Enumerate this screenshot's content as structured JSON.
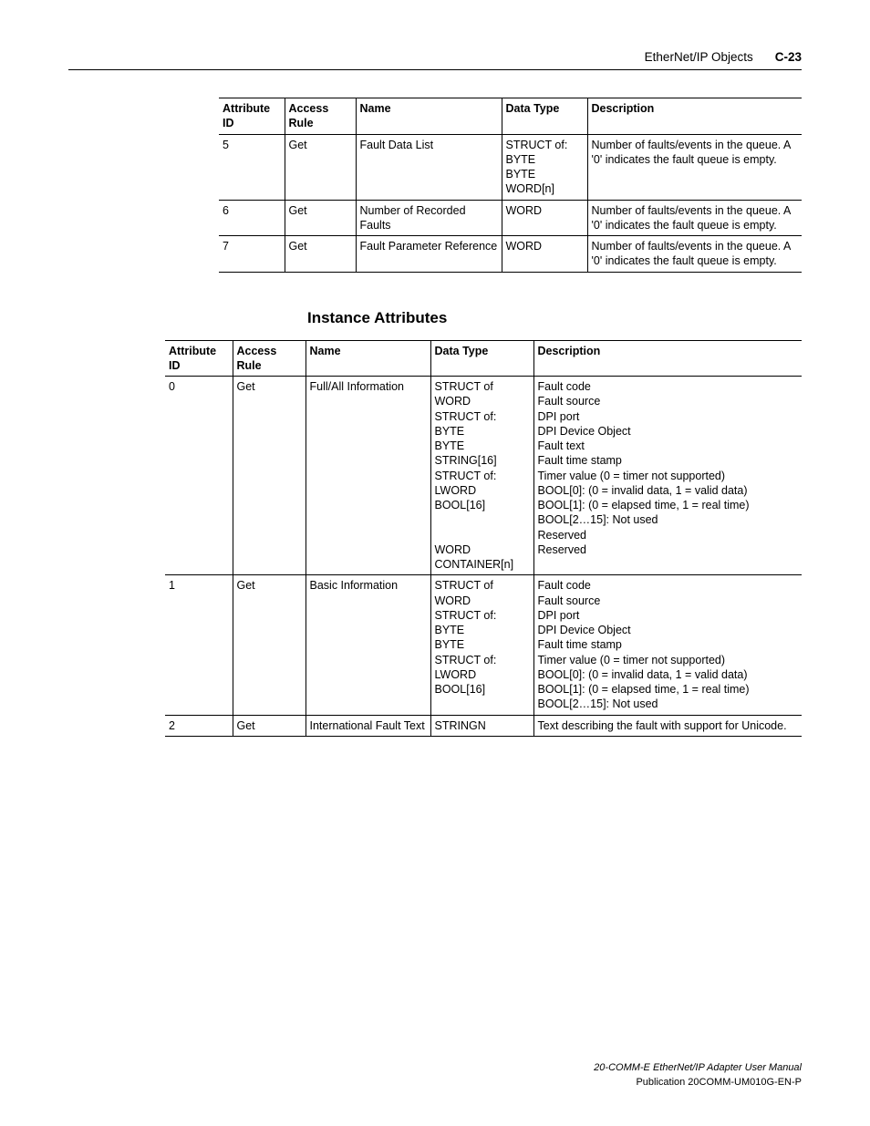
{
  "header": {
    "section_name": "EtherNet/IP Objects",
    "page_num": "C-23"
  },
  "table1": {
    "headers": {
      "attr_id": "Attribute ID",
      "access_rule": "Access Rule",
      "name": "Name",
      "data_type": "Data Type",
      "description": "Description"
    },
    "rows": [
      {
        "attr_id": "5",
        "access_rule": "Get",
        "name": "Fault Data List",
        "data_type": "STRUCT of:\n  BYTE\n  BYTE\n  WORD[n]",
        "description": "Number of faults/events in the queue. A '0' indicates the fault queue is empty."
      },
      {
        "attr_id": "6",
        "access_rule": "Get",
        "name": "Number of Recorded Faults",
        "data_type": "WORD",
        "description": "Number of faults/events in the queue. A '0' indicates the fault queue is empty."
      },
      {
        "attr_id": "7",
        "access_rule": "Get",
        "name": "Fault Parameter Reference",
        "data_type": "WORD",
        "description": "Number of faults/events in the queue. A '0' indicates the fault queue is empty."
      }
    ]
  },
  "section_heading": "Instance Attributes",
  "table2": {
    "headers": {
      "attr_id": "Attribute ID",
      "access_rule": "Access Rule",
      "name": "Name",
      "data_type": "Data Type",
      "description": "Description"
    },
    "rows": [
      {
        "attr_id": "0",
        "access_rule": "Get",
        "name": "Full/All Information",
        "data_type": "STRUCT of WORD\nSTRUCT of:\n  BYTE\n  BYTE\n  STRING[16]\nSTRUCT of:\n  LWORD\n  BOOL[16]\n\n\nWORD\nCONTAINER[n]",
        "description": "Fault code\nFault source\nDPI port\nDPI Device Object\nFault text\nFault time stamp\nTimer value (0 = timer not supported)\nBOOL[0]: (0 = invalid data, 1 = valid data)\nBOOL[1]: (0 = elapsed time, 1 = real time)\nBOOL[2…15]: Not used\nReserved\nReserved"
      },
      {
        "attr_id": "1",
        "access_rule": "Get",
        "name": "Basic Information",
        "data_type": "STRUCT of WORD\nSTRUCT of:\n  BYTE\n  BYTE\nSTRUCT of:\n  LWORD\n  BOOL[16]",
        "description": "Fault code\nFault source\nDPI port\nDPI Device Object\nFault time stamp\nTimer value (0 = timer not supported)\nBOOL[0]: (0 = invalid data, 1 = valid data)\nBOOL[1]: (0 = elapsed time, 1 = real time)\nBOOL[2…15]: Not used"
      },
      {
        "attr_id": "2",
        "access_rule": "Get",
        "name": "International Fault Text",
        "data_type": "STRINGN",
        "description": "Text describing the fault with support for Unicode."
      }
    ]
  },
  "footer": {
    "line1": "20-COMM-E EtherNet/IP Adapter User Manual",
    "line2": "Publication 20COMM-UM010G-EN-P"
  }
}
